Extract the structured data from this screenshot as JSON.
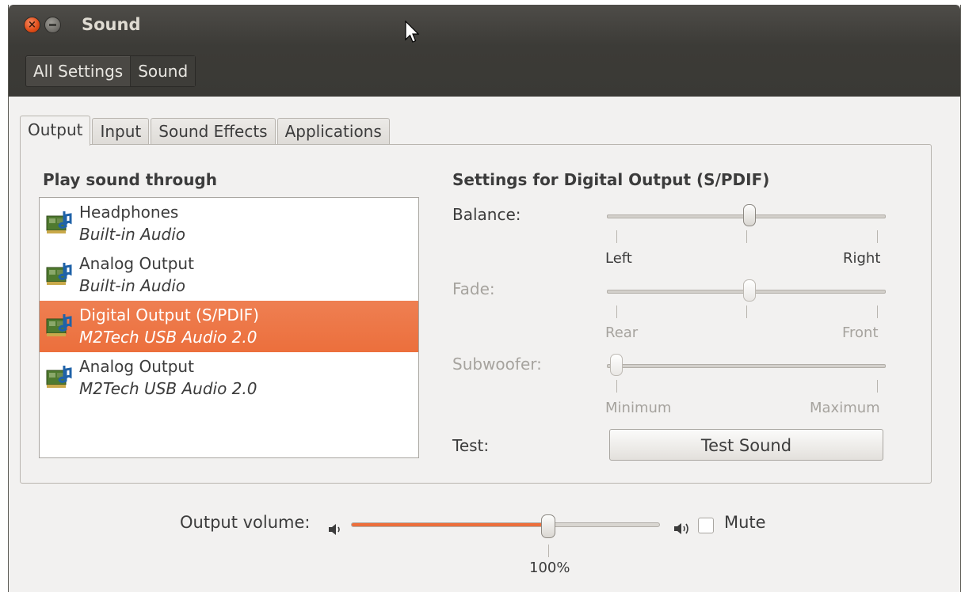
{
  "window": {
    "title": "Sound",
    "breadcrumb": [
      "All Settings",
      "Sound"
    ]
  },
  "tabs": [
    {
      "label": "Output",
      "active": true
    },
    {
      "label": "Input",
      "active": false
    },
    {
      "label": "Sound Effects",
      "active": false
    },
    {
      "label": "Applications",
      "active": false
    }
  ],
  "output": {
    "heading": "Play sound through",
    "devices": [
      {
        "name": "Headphones",
        "description": "Built-in Audio",
        "selected": false,
        "icon": "sound-card-icon"
      },
      {
        "name": "Analog Output",
        "description": "Built-in Audio",
        "selected": false,
        "icon": "sound-card-icon"
      },
      {
        "name": "Digital Output (S/PDIF)",
        "description": "M2Tech USB Audio 2.0",
        "selected": true,
        "icon": "sound-card-icon"
      },
      {
        "name": "Analog Output",
        "description": "M2Tech USB Audio 2.0",
        "selected": false,
        "icon": "sound-card-icon"
      }
    ]
  },
  "settings": {
    "heading": "Settings for Digital Output (S/PDIF)",
    "balance": {
      "label": "Balance:",
      "left": "Left",
      "right": "Right",
      "value": 0.5,
      "enabled": true
    },
    "fade": {
      "label": "Fade:",
      "left": "Rear",
      "right": "Front",
      "value": 0.5,
      "enabled": false
    },
    "subwoofer": {
      "label": "Subwoofer:",
      "left": "Minimum",
      "right": "Maximum",
      "value": 0.0,
      "enabled": false
    },
    "test": {
      "label": "Test:",
      "button": "Test Sound"
    }
  },
  "volume": {
    "label": "Output volume:",
    "level": 0.64,
    "percent_label": "100%",
    "mute_label": "Mute",
    "muted": false,
    "low_icon": "speaker-low-icon",
    "high_icon": "speaker-high-icon"
  },
  "colors": {
    "accent": "#ec6f3c",
    "titlebar": "#3c3b37",
    "window_bg": "#f2f1f0"
  }
}
